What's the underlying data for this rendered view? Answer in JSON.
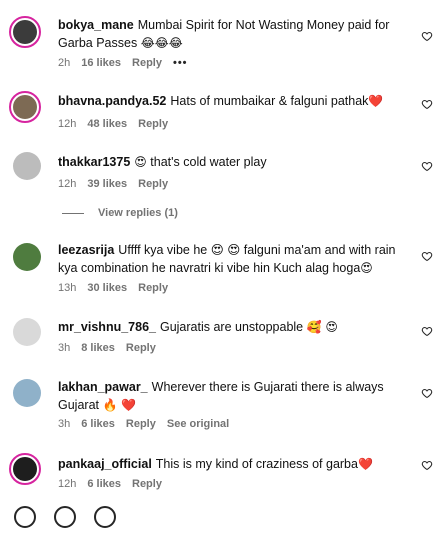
{
  "comments": [
    {
      "username": "bokya_mane",
      "text": "Mumbai Spirit for Not Wasting Money paid for Garba Passes",
      "emoji": "😂😂😂",
      "time": "2h",
      "likes": "16 likes",
      "reply": "Reply",
      "more": "•••"
    },
    {
      "username": "bhavna.pandya.52",
      "text": "Hats of mumbaikar & falguni pathak",
      "emoji": "❤️",
      "time": "12h",
      "likes": "48 likes",
      "reply": "Reply"
    },
    {
      "username": "thakkar1375",
      "pre_emoji": "😍",
      "text": "that's cold water play",
      "time": "12h",
      "likes": "39 likes",
      "reply": "Reply"
    },
    {
      "username": "leezasrija",
      "text": "Uffff kya vibe he 😍 😍 falguni ma'am and with rain kya combination he navratri ki vibe hin Kuch alag hoga",
      "emoji": "😍",
      "time": "13h",
      "likes": "30 likes",
      "reply": "Reply"
    },
    {
      "username": "mr_vishnu_786_",
      "text": "Gujaratis are unstoppable",
      "emoji": "🥰 😍",
      "time": "3h",
      "likes": "8 likes",
      "reply": "Reply"
    },
    {
      "username": "lakhan_pawar_",
      "text": "Wherever there is Gujarati there is always Gujarat",
      "emoji": "🔥 ❤️",
      "time": "3h",
      "likes": "6 likes",
      "reply": "Reply",
      "extra": "See original"
    },
    {
      "username": "pankaaj_official",
      "text": "This is my kind of craziness of garba",
      "emoji": "❤️",
      "time": "12h",
      "likes": "6 likes",
      "reply": "Reply"
    }
  ],
  "view_replies": "View replies (1)"
}
